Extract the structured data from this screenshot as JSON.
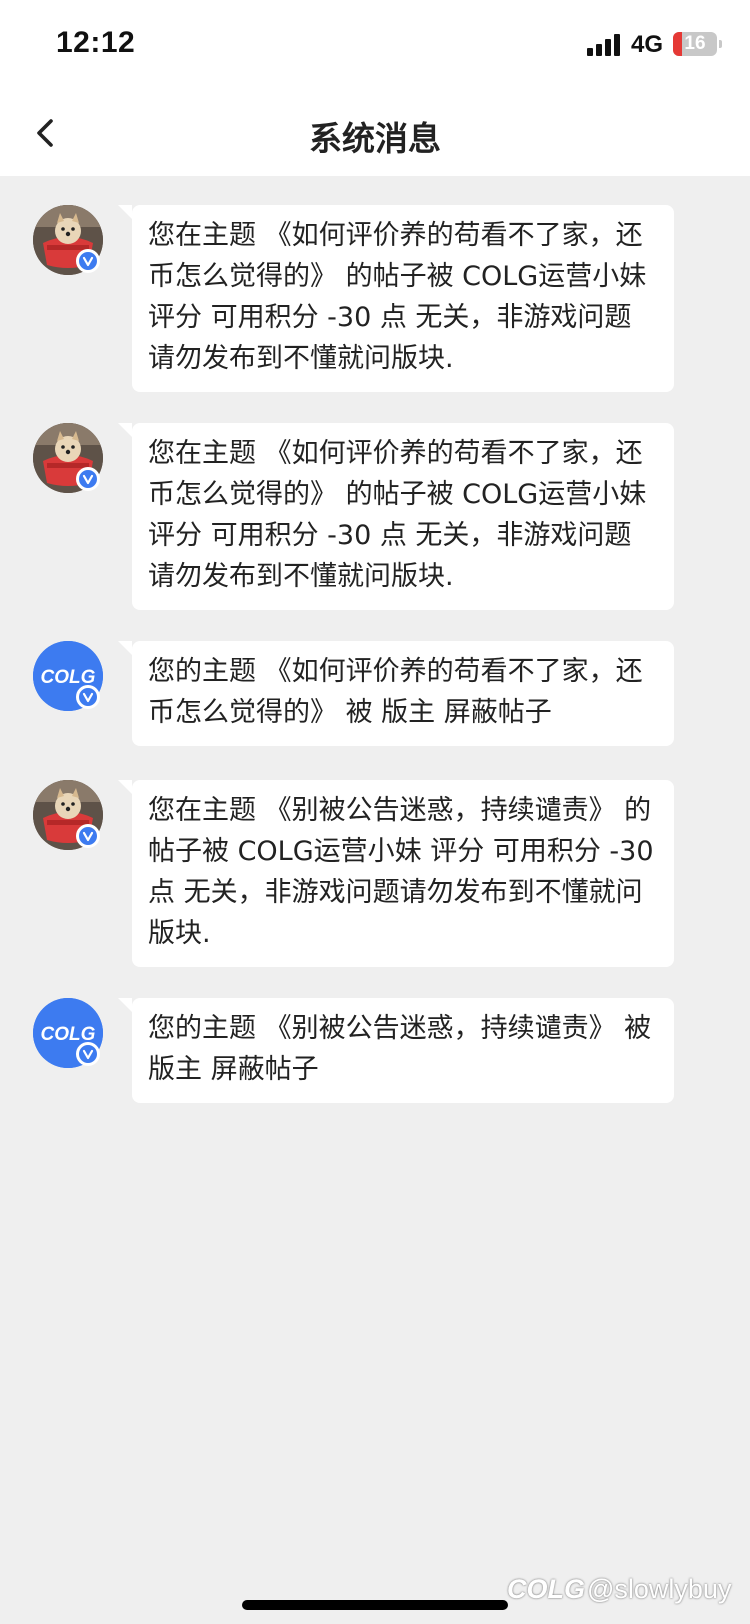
{
  "status_bar": {
    "time": "12:12",
    "network": "4G",
    "battery": "16"
  },
  "header": {
    "title": "系统消息"
  },
  "messages": [
    {
      "avatar": "dog-photo",
      "text": "您在主题 《如何评价养的苟看不了家，还币怎么觉得的》 的帖子被 COLG运营小妹 评分 可用积分 -30 点 无关，非游戏问题请勿发布到不懂就问版块."
    },
    {
      "avatar": "dog-photo",
      "text": "您在主题 《如何评价养的苟看不了家，还币怎么觉得的》 的帖子被 COLG运营小妹 评分 可用积分 -30 点 无关，非游戏问题请勿发布到不懂就问版块."
    },
    {
      "avatar": "colg-logo",
      "text": "您的主题 《如何评价养的苟看不了家，还币怎么觉得的》 被 版主 屏蔽帖子"
    },
    {
      "avatar": "dog-photo",
      "text": "您在主题 《别被公告迷惑，持续谴责》 的帖子被 COLG运营小妹 评分 可用积分 -30 点 无关，非游戏问题请勿发布到不懂就问版块."
    },
    {
      "avatar": "colg-logo",
      "text": "您的主题 《别被公告迷惑，持续谴责》 被 版主 屏蔽帖子"
    }
  ],
  "avatar_logo_text": "COLG",
  "watermark": {
    "logo": "COLG",
    "handle": "@slowlybuy"
  },
  "colors": {
    "page_bg": "#efefef",
    "bubble_bg": "#ffffff",
    "verified_badge": "#3d7bf0",
    "colg_blue": "#3d7bf0",
    "battery_low": "#e53935"
  }
}
